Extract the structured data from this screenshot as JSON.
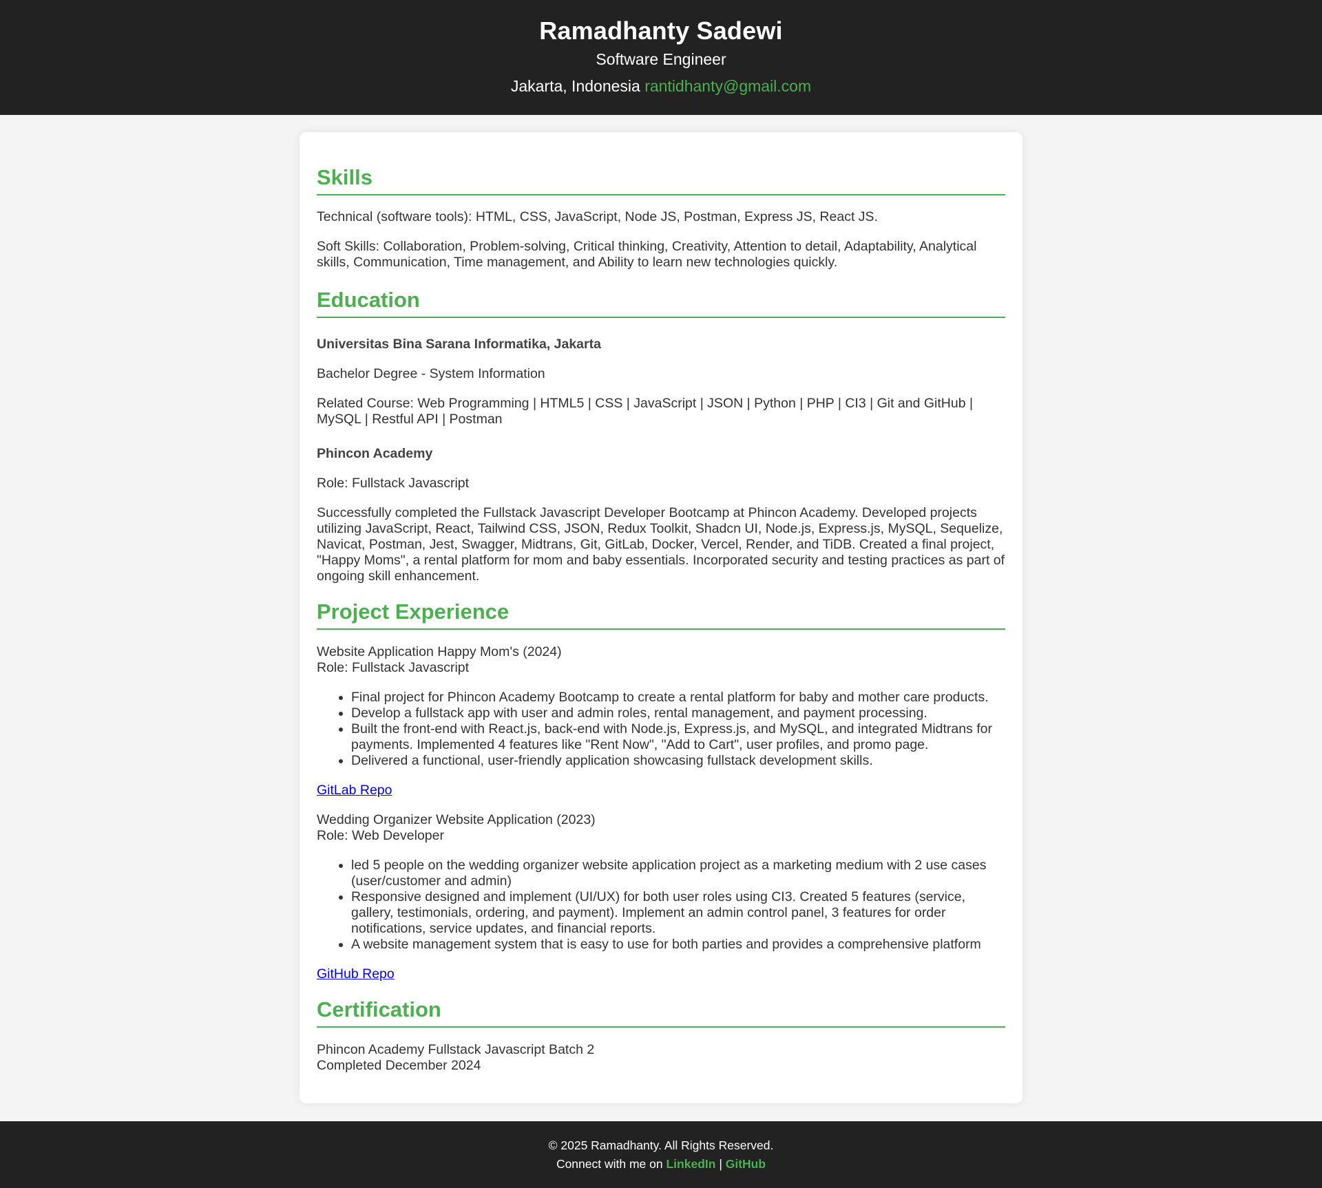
{
  "header": {
    "name": "Ramadhanty Sadewi",
    "title": "Software Engineer",
    "location": "Jakarta, Indonesia",
    "email": "rantidhanty@gmail.com"
  },
  "skills": {
    "heading": "Skills",
    "technical": "Technical (software tools): HTML, CSS, JavaScript, Node JS, Postman, Express JS, React JS.",
    "soft": "Soft Skills: Collaboration, Problem-solving, Critical thinking, Creativity, Attention to detail, Adaptability, Analytical skills, Communication, Time management, and Ability to learn new technologies quickly."
  },
  "education": {
    "heading": "Education",
    "items": [
      {
        "org": "Universitas Bina Sarana Informatika, Jakarta",
        "line1": "Bachelor Degree - System Information",
        "line2": "Related Course: Web Programming | HTML5 | CSS | JavaScript | JSON | Python | PHP | CI3 | Git and GitHub | MySQL | Restful API | Postman"
      },
      {
        "org": "Phincon Academy",
        "line1": "Role: Fullstack Javascript",
        "line2": "Successfully completed the Fullstack Javascript Developer Bootcamp at Phincon Academy. Developed projects utilizing JavaScript, React, Tailwind CSS, JSON, Redux Toolkit, Shadcn UI, Node.js, Express.js, MySQL, Sequelize, Navicat, Postman, Jest, Swagger, Midtrans, Git, GitLab, Docker, Vercel, Render, and TiDB. Created a final project, \"Happy Moms\", a rental platform for mom and baby essentials. Incorporated security and testing practices as part of ongoing skill enhancement."
      }
    ]
  },
  "projects": {
    "heading": "Project Experience",
    "items": [
      {
        "title": "Website Application Happy Mom's (2024)",
        "role": "Role: Fullstack Javascript",
        "bullets": [
          "Final project for Phincon Academy Bootcamp to create a rental platform for baby and mother care products.",
          "Develop a fullstack app with user and admin roles, rental management, and payment processing.",
          "Built the front-end with React.js, back-end with Node.js, Express.js, and MySQL, and integrated Midtrans for payments. Implemented 4 features like \"Rent Now\", \"Add to Cart\", user profiles, and promo page.",
          "Delivered a functional, user-friendly application showcasing fullstack development skills."
        ],
        "link": "GitLab Repo"
      },
      {
        "title": "Wedding Organizer Website Application (2023)",
        "role": "Role: Web Developer",
        "bullets": [
          "led 5 people on the wedding organizer website application project as a marketing medium with 2 use cases (user/customer and admin)",
          "Responsive designed and implement (UI/UX) for both user roles using CI3. Created 5 features (service, gallery, testimonials, ordering, and payment). Implement an admin control panel, 3 features for order notifications, service updates, and financial reports.",
          "A website management system that is easy to use for both parties and provides a comprehensive platform"
        ],
        "link": "GitHub Repo"
      }
    ]
  },
  "certification": {
    "heading": "Certification",
    "name": "Phincon Academy Fullstack Javascript Batch 2",
    "date": "Completed December 2024"
  },
  "footer": {
    "copyright": "© 2025 Ramadhanty. All Rights Reserved.",
    "connect": "Connect with me on",
    "linkedin": "LinkedIn",
    "separator": "|",
    "github": "GitHub"
  },
  "colors": {
    "accent": "#4caf50",
    "header_bg": "#222222",
    "page_bg": "#f4f4f4",
    "link": "#0000ee"
  }
}
